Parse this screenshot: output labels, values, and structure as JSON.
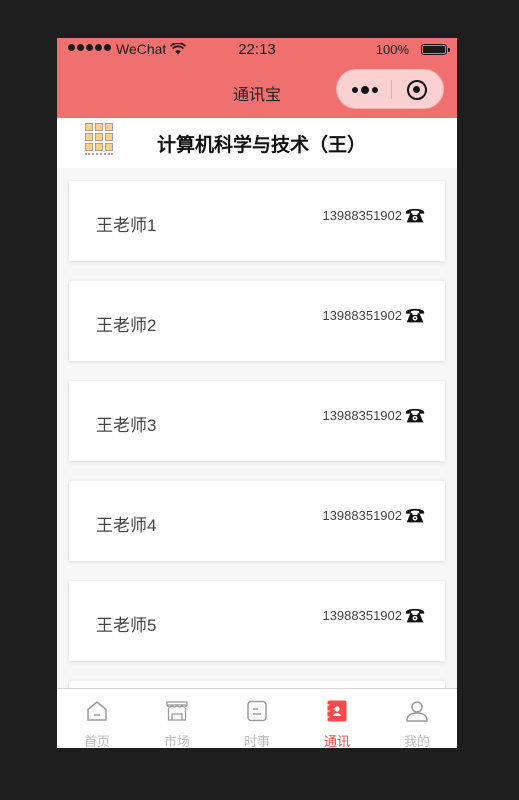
{
  "status": {
    "carrier": "WeChat",
    "time": "22:13",
    "battery": "100%"
  },
  "nav": {
    "title": "通讯宝"
  },
  "header": {
    "title": "计算机科学与技术（王）"
  },
  "contacts": [
    {
      "name": "王老师1",
      "phone": "13988351902"
    },
    {
      "name": "王老师2",
      "phone": "13988351902"
    },
    {
      "name": "王老师3",
      "phone": "13988351902"
    },
    {
      "name": "王老师4",
      "phone": "13988351902"
    },
    {
      "name": "王老师5",
      "phone": "13988351902"
    }
  ],
  "tabs": [
    {
      "label": "首页",
      "icon": "home-icon"
    },
    {
      "label": "市场",
      "icon": "shop-icon"
    },
    {
      "label": "时事",
      "icon": "news-icon"
    },
    {
      "label": "通讯",
      "icon": "contacts-icon",
      "active": true
    },
    {
      "label": "我的",
      "icon": "user-icon"
    }
  ],
  "colors": {
    "accent": "#f07070",
    "active_tab": "#f14b4b",
    "inactive_tab": "#bdbdbd"
  }
}
